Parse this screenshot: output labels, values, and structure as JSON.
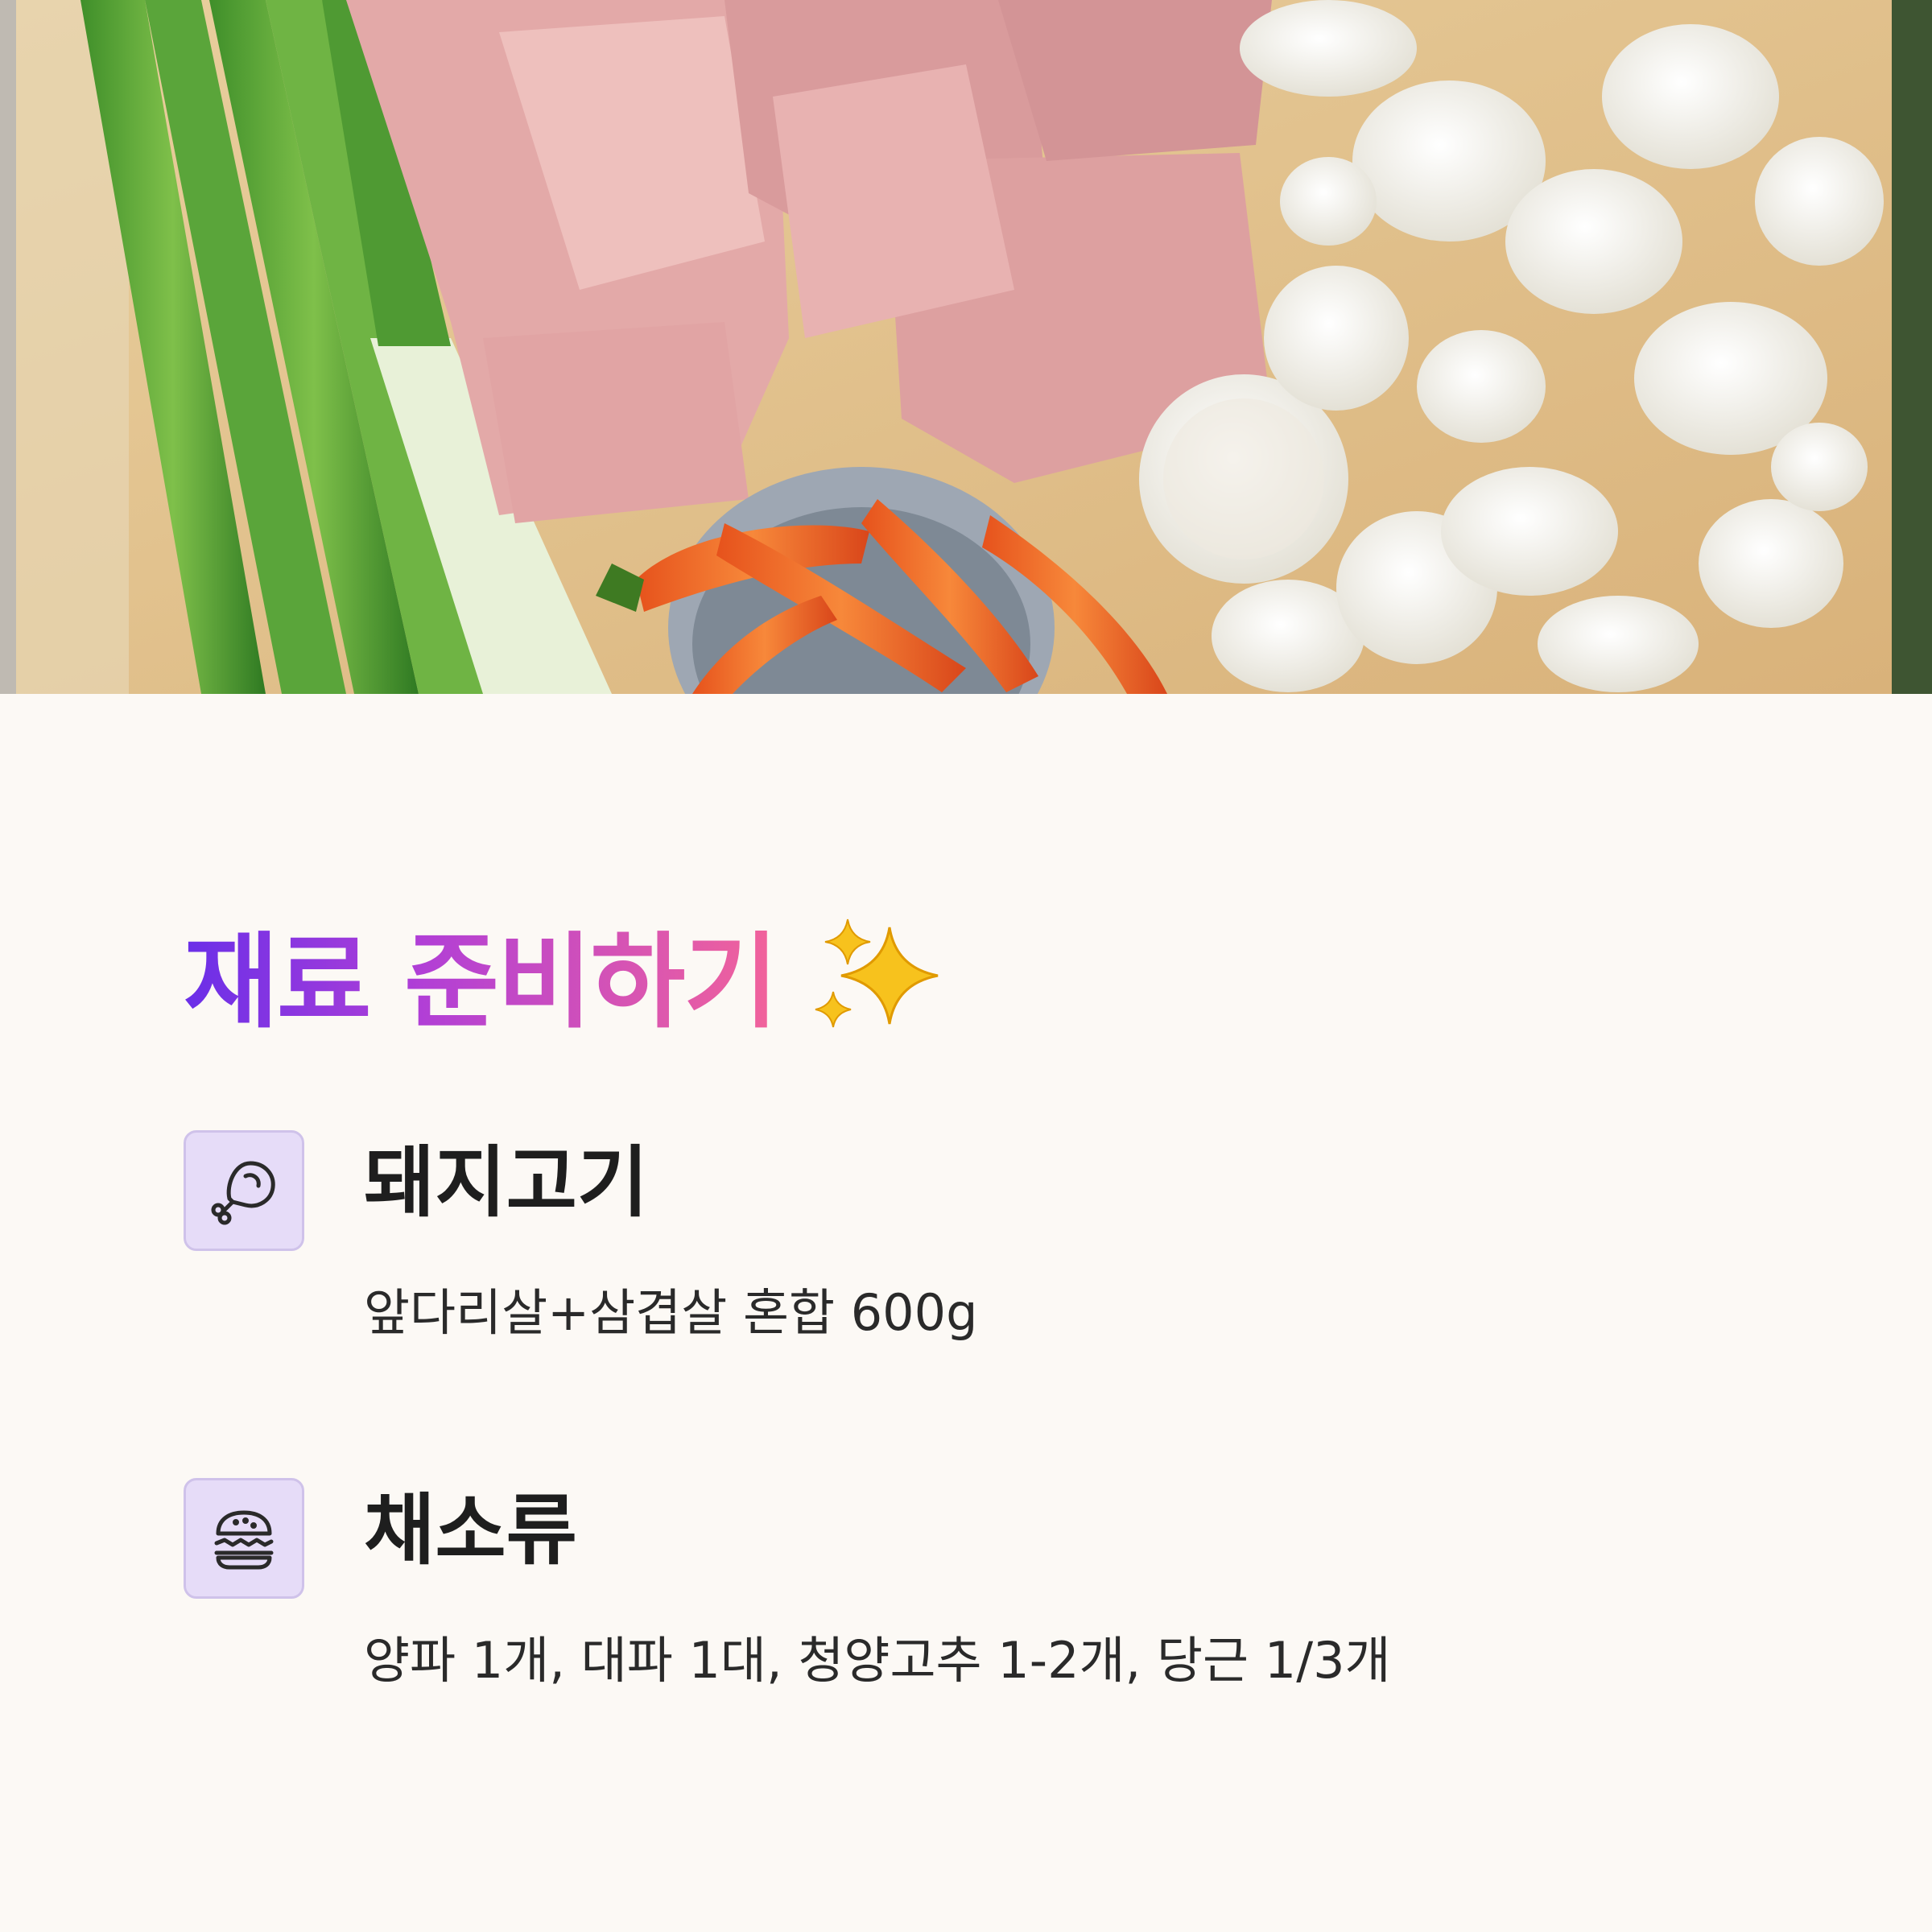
{
  "hero": {
    "image": "ingredients-photo",
    "subject": [
      "green-onion",
      "pork-slices",
      "carrots",
      "onion"
    ]
  },
  "heading": {
    "text": "재료 준비하기",
    "emoji": "✨"
  },
  "colors": {
    "accent_start": "#6a2fe8",
    "accent_mid": "#b13fd6",
    "accent_end": "#f2639a",
    "icon_bg": "#e6dcf8",
    "page_bg": "#fcf9f5"
  },
  "ingredients": [
    {
      "icon": "meat-drumstick-icon",
      "title": "돼지고기",
      "desc": "앞다리살+삼겹살 혼합 600g"
    },
    {
      "icon": "burger-icon",
      "title": "채소류",
      "desc": "양파 1개, 대파 1대, 청양고추 1-2개, 당근 1/3개"
    }
  ]
}
